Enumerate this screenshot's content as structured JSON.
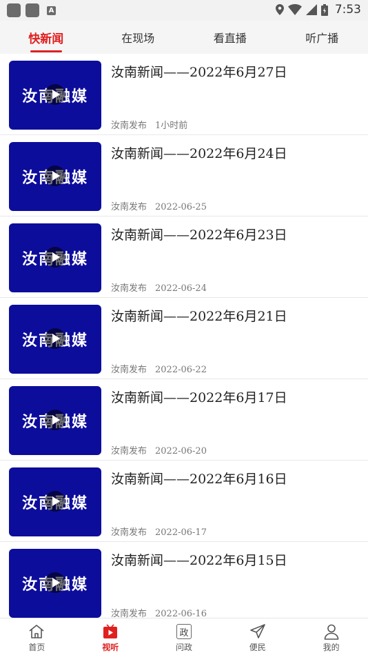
{
  "status_bar": {
    "time": "7:53",
    "icons": [
      "app-icon",
      "app-icon",
      "keyboard-a-icon",
      "location-icon",
      "wifi-icon",
      "signal-icon",
      "battery-icon"
    ]
  },
  "top_tabs": [
    {
      "label": "快新闻",
      "active": true
    },
    {
      "label": "在现场",
      "active": false
    },
    {
      "label": "看直播",
      "active": false
    },
    {
      "label": "听广播",
      "active": false
    }
  ],
  "thumbnail": {
    "text": "汝南融媒",
    "background": "#0d0d9c",
    "icon": "play-icon"
  },
  "news": [
    {
      "title": "汝南新闻——2022年6月27日",
      "source": "汝南发布",
      "time": "1小时前"
    },
    {
      "title": "汝南新闻——2022年6月24日",
      "source": "汝南发布",
      "time": "2022-06-25"
    },
    {
      "title": "汝南新闻——2022年6月23日",
      "source": "汝南发布",
      "time": "2022-06-24"
    },
    {
      "title": "汝南新闻——2022年6月21日",
      "source": "汝南发布",
      "time": "2022-06-22"
    },
    {
      "title": "汝南新闻——2022年6月17日",
      "source": "汝南发布",
      "time": "2022-06-20"
    },
    {
      "title": "汝南新闻——2022年6月16日",
      "source": "汝南发布",
      "time": "2022-06-17"
    },
    {
      "title": "汝南新闻——2022年6月15日",
      "source": "汝南发布",
      "time": "2022-06-16"
    }
  ],
  "bottom_nav": [
    {
      "label": "首页",
      "icon": "home-icon",
      "active": false
    },
    {
      "label": "视听",
      "icon": "video-icon",
      "active": true
    },
    {
      "label": "问政",
      "icon": "zheng-icon",
      "icon_text": "政",
      "active": false
    },
    {
      "label": "便民",
      "icon": "send-icon",
      "active": false
    },
    {
      "label": "我的",
      "icon": "user-icon",
      "active": false
    }
  ],
  "colors": {
    "accent": "#e02020",
    "thumb_bg": "#0d0d9c"
  }
}
